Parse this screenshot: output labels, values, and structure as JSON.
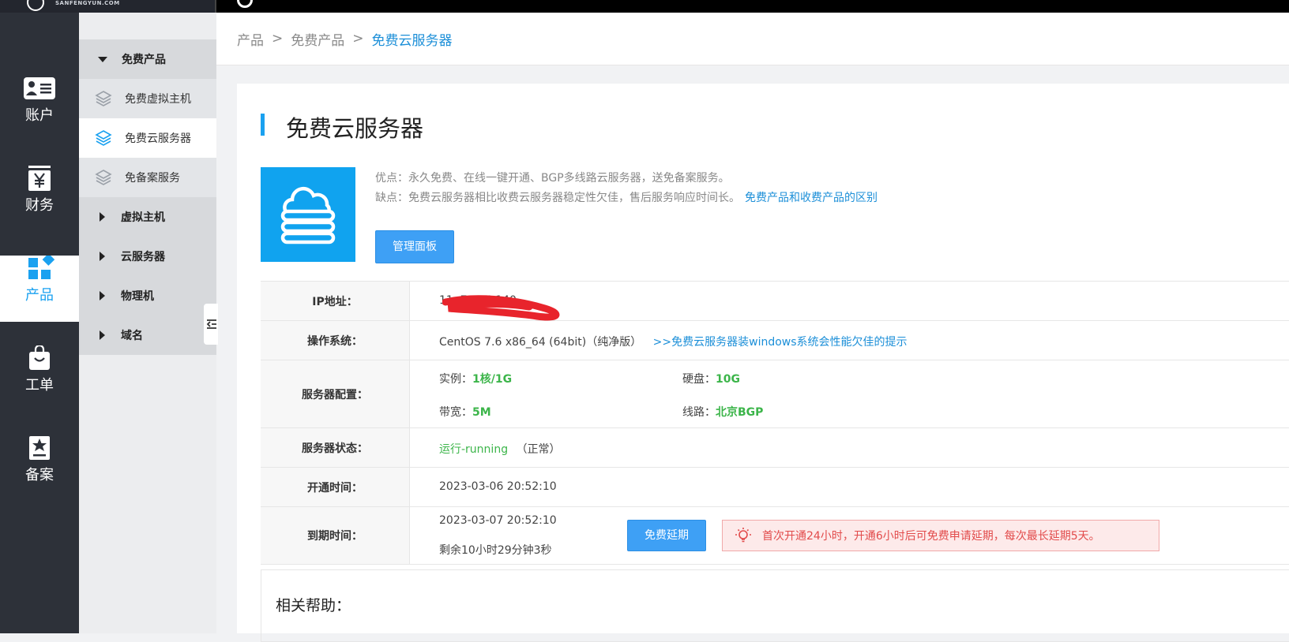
{
  "topbar": {
    "logo_text": "SANFENGYUN.COM"
  },
  "leftnav": [
    {
      "label": "账户",
      "icon": "account-card-icon"
    },
    {
      "label": "财务",
      "icon": "finance-yen-icon"
    },
    {
      "label": "产品",
      "icon": "products-grid-icon",
      "active": true
    },
    {
      "label": "工单",
      "icon": "ticket-bag-icon"
    },
    {
      "label": "备案",
      "icon": "filing-star-icon"
    }
  ],
  "submenu": {
    "free_products": "免费产品",
    "free_vhost": "免费虚拟主机",
    "free_cloud": "免费云服务器",
    "free_filing": "免备案服务",
    "vhost": "虚拟主机",
    "cloud": "云服务器",
    "physical": "物理机",
    "domain": "域名"
  },
  "breadcrumb": {
    "root": "产品",
    "sep1": ">",
    "level2": "免费产品",
    "sep2": ">",
    "current": "免费云服务器"
  },
  "page": {
    "title": "免费云服务器",
    "pros": "优点：永久免费、在线一键开通、BGP多线路云服务器，送免备案服务。",
    "cons": "缺点：免费云服务器相比收费云服务器稳定性欠佳，售后服务响应时间长。",
    "diff_link": "免费产品和收费产品的区别",
    "manage_button": "管理面板"
  },
  "info": {
    "ip_label": "IP地址：",
    "ip_value": "11.  7.194.140",
    "os_label": "操作系统：",
    "os_value": "CentOS 7.6 x86_64 (64bit)（纯净版）",
    "os_link": ">>免费云服务器装windows系统会性能欠佳的提示",
    "config_label": "服务器配置：",
    "instance_label": "实例：",
    "instance_value": "1核/1G",
    "disk_label": "硬盘：",
    "disk_value": "10G",
    "bandwidth_label": "带宽：",
    "bandwidth_value": "5M",
    "line_label": "线路：",
    "line_value": "北京BGP",
    "status_label": "服务器状态：",
    "status_value": "运行-running",
    "status_note": "（正常）",
    "open_label": "开通时间：",
    "open_value": "2023-03-06 20:52:10",
    "expire_label": "到期时间：",
    "expire_value": "2023-03-07 20:52:10",
    "remaining": "剩余10小时29分钟3秒",
    "extend_button": "免费延期",
    "tip": "首次开通24小时，开通6小时后可免费申请延期，每次最长延期5天。"
  },
  "help": {
    "title": "相关帮助："
  },
  "colors": {
    "accent": "#1aa1f0",
    "nav_bg": "#2d3139",
    "green": "#3cb54a",
    "red": "#e8001c"
  }
}
